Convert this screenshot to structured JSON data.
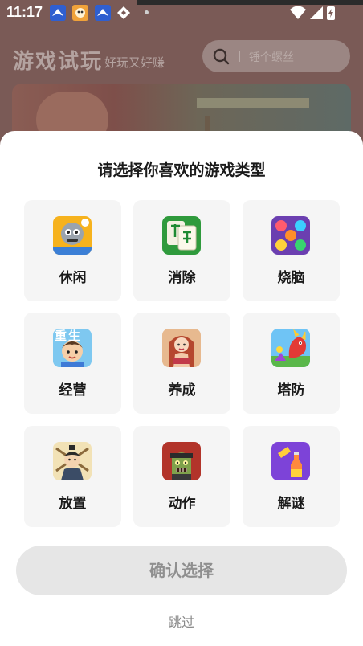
{
  "status_bar": {
    "time": "11:17"
  },
  "header": {
    "title": "游戏试玩",
    "subtitle": "好玩又好赚"
  },
  "search": {
    "placeholder": "锤个螺丝"
  },
  "dialog": {
    "title": "请选择你喜欢的游戏类型",
    "genres": [
      {
        "label": "休闲",
        "icon": "casual-game-icon"
      },
      {
        "label": "消除",
        "icon": "mahjong-tile-icon"
      },
      {
        "label": "烧脑",
        "icon": "color-balls-puzzle-icon"
      },
      {
        "label": "经营",
        "icon": "kid-character-icon"
      },
      {
        "label": "养成",
        "icon": "girl-character-icon"
      },
      {
        "label": "塔防",
        "icon": "dragon-icon"
      },
      {
        "label": "放置",
        "icon": "warrior-character-icon"
      },
      {
        "label": "动作",
        "icon": "zombie-icon"
      },
      {
        "label": "解谜",
        "icon": "bottle-puzzle-icon"
      }
    ],
    "icon_overlay_text": "重生",
    "confirm_label": "确认选择",
    "skip_label": "跳过"
  },
  "colors": {
    "dim_overlay_bg": "#7a5a56",
    "card_bg": "#f5f5f5",
    "confirm_disabled_bg": "#e6e6e6",
    "confirm_disabled_text": "#8f8f8f"
  }
}
